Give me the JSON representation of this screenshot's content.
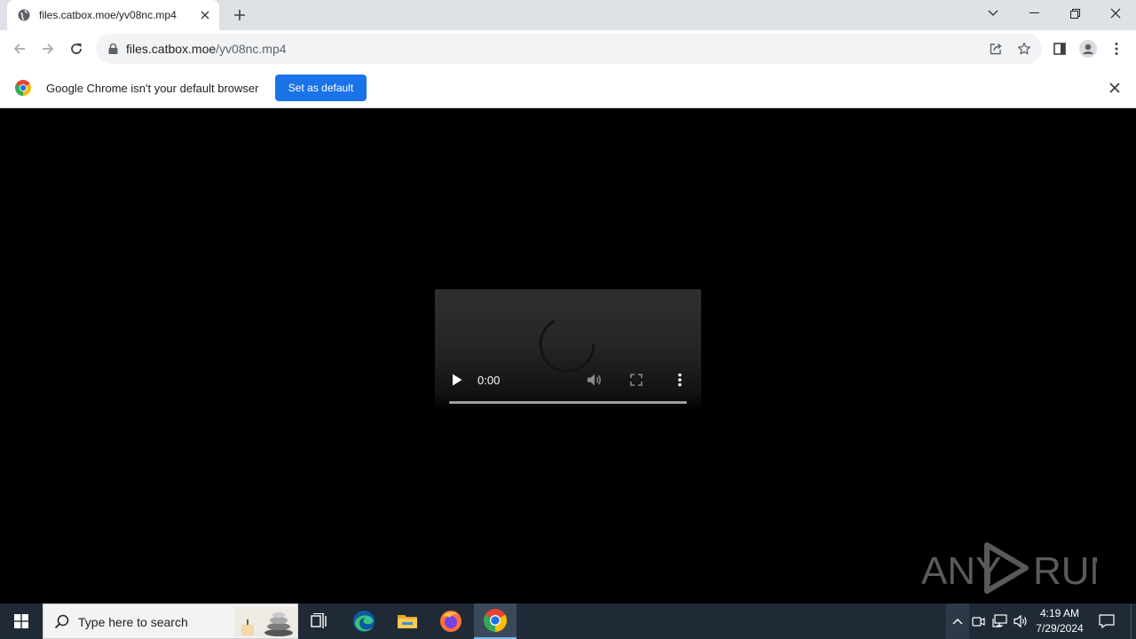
{
  "tab": {
    "title": "files.catbox.moe/yv08nc.mp4"
  },
  "omnibox": {
    "host": "files.catbox.moe",
    "path": "/yv08nc.mp4"
  },
  "infobar": {
    "message": "Google Chrome isn't your default browser",
    "button_label": "Set as default"
  },
  "video": {
    "time": "0:00",
    "progress_fraction": 0
  },
  "watermark": {
    "text_left": "ANY",
    "text_right": "RUN"
  },
  "taskbar": {
    "search_placeholder": "Type here to search",
    "apps": [
      "task-view",
      "edge",
      "file-explorer",
      "firefox",
      "chrome"
    ],
    "active_app": "chrome"
  },
  "clock": {
    "time": "4:19 AM",
    "date": "7/29/2024"
  },
  "colors": {
    "accent": "#1a73e8",
    "tabstrip": "#dee1e6",
    "taskbar": "#1f2a36"
  }
}
